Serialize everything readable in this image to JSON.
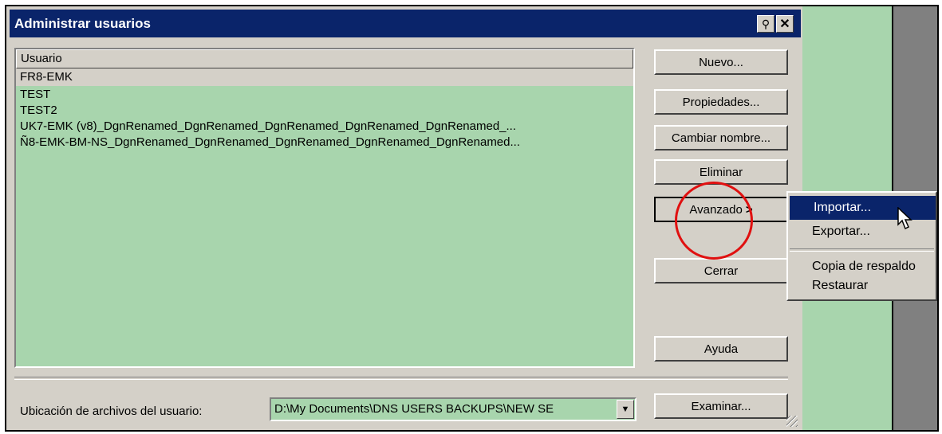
{
  "window": {
    "title": "Administrar usuarios",
    "help_button_glyph": "⚲",
    "close_button_glyph": "✕"
  },
  "user_list": {
    "column_header": "Usuario",
    "rows": [
      "FR8-EMK",
      "TEST",
      "TEST2",
      "UK7-EMK (v8)_DgnRenamed_DgnRenamed_DgnRenamed_DgnRenamed_DgnRenamed_...",
      "Ñ8-EMK-BM-NS_DgnRenamed_DgnRenamed_DgnRenamed_DgnRenamed_DgnRenamed..."
    ]
  },
  "buttons": {
    "new": "Nuevo...",
    "properties": "Propiedades...",
    "rename": "Cambiar nombre...",
    "delete": "Eliminar",
    "advanced": "Avanzado",
    "advanced_arrow": ">",
    "close": "Cerrar",
    "help": "Ayuda",
    "browse": "Examinar..."
  },
  "location": {
    "label": "Ubicación de archivos del usuario:",
    "value": "D:\\My Documents\\DNS USERS BACKUPS\\NEW SE",
    "arrow": "▼"
  },
  "advanced_menu": {
    "items": [
      "Importar...",
      "Exportar...",
      "Copia de respaldo",
      "Restaurar"
    ]
  },
  "colors": {
    "title_bar": "#0a246a",
    "list_background": "#a8d5ad",
    "highlight_circle": "#e01010"
  }
}
